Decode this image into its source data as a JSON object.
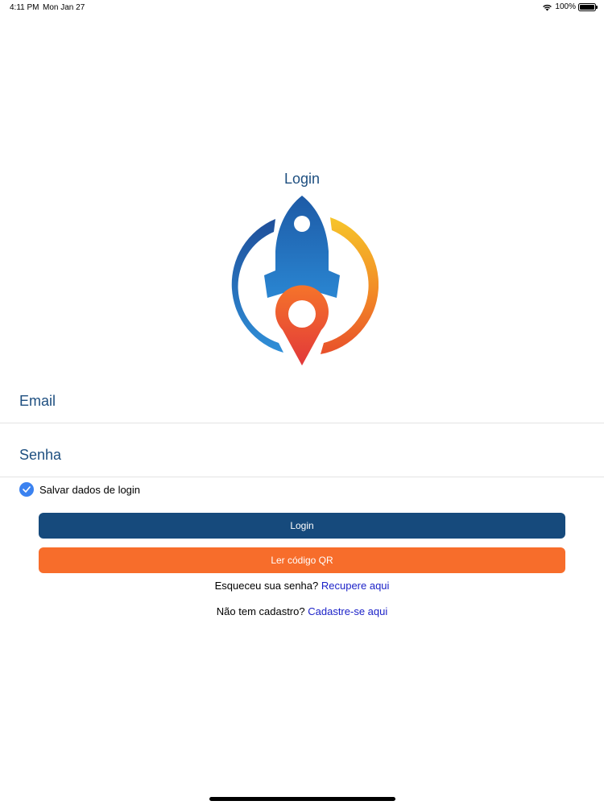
{
  "status_bar": {
    "time": "4:11 PM",
    "date": "Mon Jan 27",
    "battery": "100%",
    "icons": [
      "wifi-icon",
      "battery-icon"
    ]
  },
  "page": {
    "title": "Login"
  },
  "form": {
    "email_label": "Email",
    "email_value": "",
    "password_label": "Senha",
    "password_value": "",
    "save_login_label": "Salvar dados de login",
    "save_login_checked": true
  },
  "buttons": {
    "login_label": "Login",
    "qr_label": "Ler código QR"
  },
  "links": {
    "forgot_prefix": "Esqueceu sua senha?",
    "forgot_link": "Recupere aqui",
    "signup_prefix": "Não tem cadastro?",
    "signup_link": "Cadastre-se aqui"
  },
  "colors": {
    "primary": "#164a7c",
    "accent": "#f76d2b",
    "label": "#1e4f80",
    "link": "#1c22c8",
    "checkbox": "#3b82f0"
  }
}
